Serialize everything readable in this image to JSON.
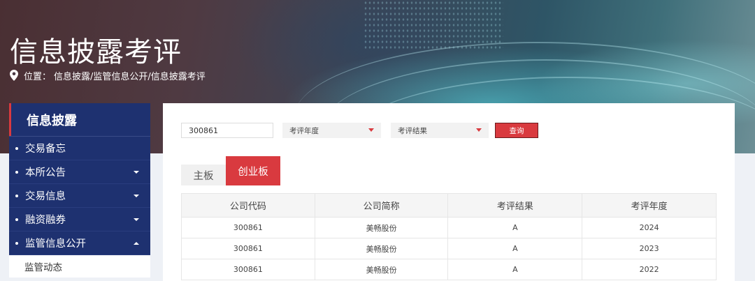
{
  "page": {
    "title": "信息披露考评",
    "breadcrumb_label": "位置：",
    "breadcrumb_path": "信息披露/监管信息公开/信息披露考评"
  },
  "sidebar": {
    "header": "信息披露",
    "items": [
      {
        "label": "交易备忘"
      },
      {
        "label": "本所公告"
      },
      {
        "label": "交易信息"
      },
      {
        "label": "融资融券"
      },
      {
        "label": "监管信息公开"
      }
    ],
    "sub_item": "监管动态"
  },
  "filters": {
    "code_value": "300861",
    "year_placeholder": "考评年度",
    "result_placeholder": "考评结果",
    "query_label": "查询"
  },
  "tabs": [
    {
      "label": "主板"
    },
    {
      "label": "创业板"
    }
  ],
  "table": {
    "headers": [
      "公司代码",
      "公司简称",
      "考评结果",
      "考评年度"
    ],
    "rows": [
      [
        "300861",
        "美畅股份",
        "A",
        "2024"
      ],
      [
        "300861",
        "美畅股份",
        "A",
        "2023"
      ],
      [
        "300861",
        "美畅股份",
        "A",
        "2022"
      ]
    ]
  },
  "colors": {
    "accent": "#d93a3f",
    "sidebar": "#1e3170"
  }
}
